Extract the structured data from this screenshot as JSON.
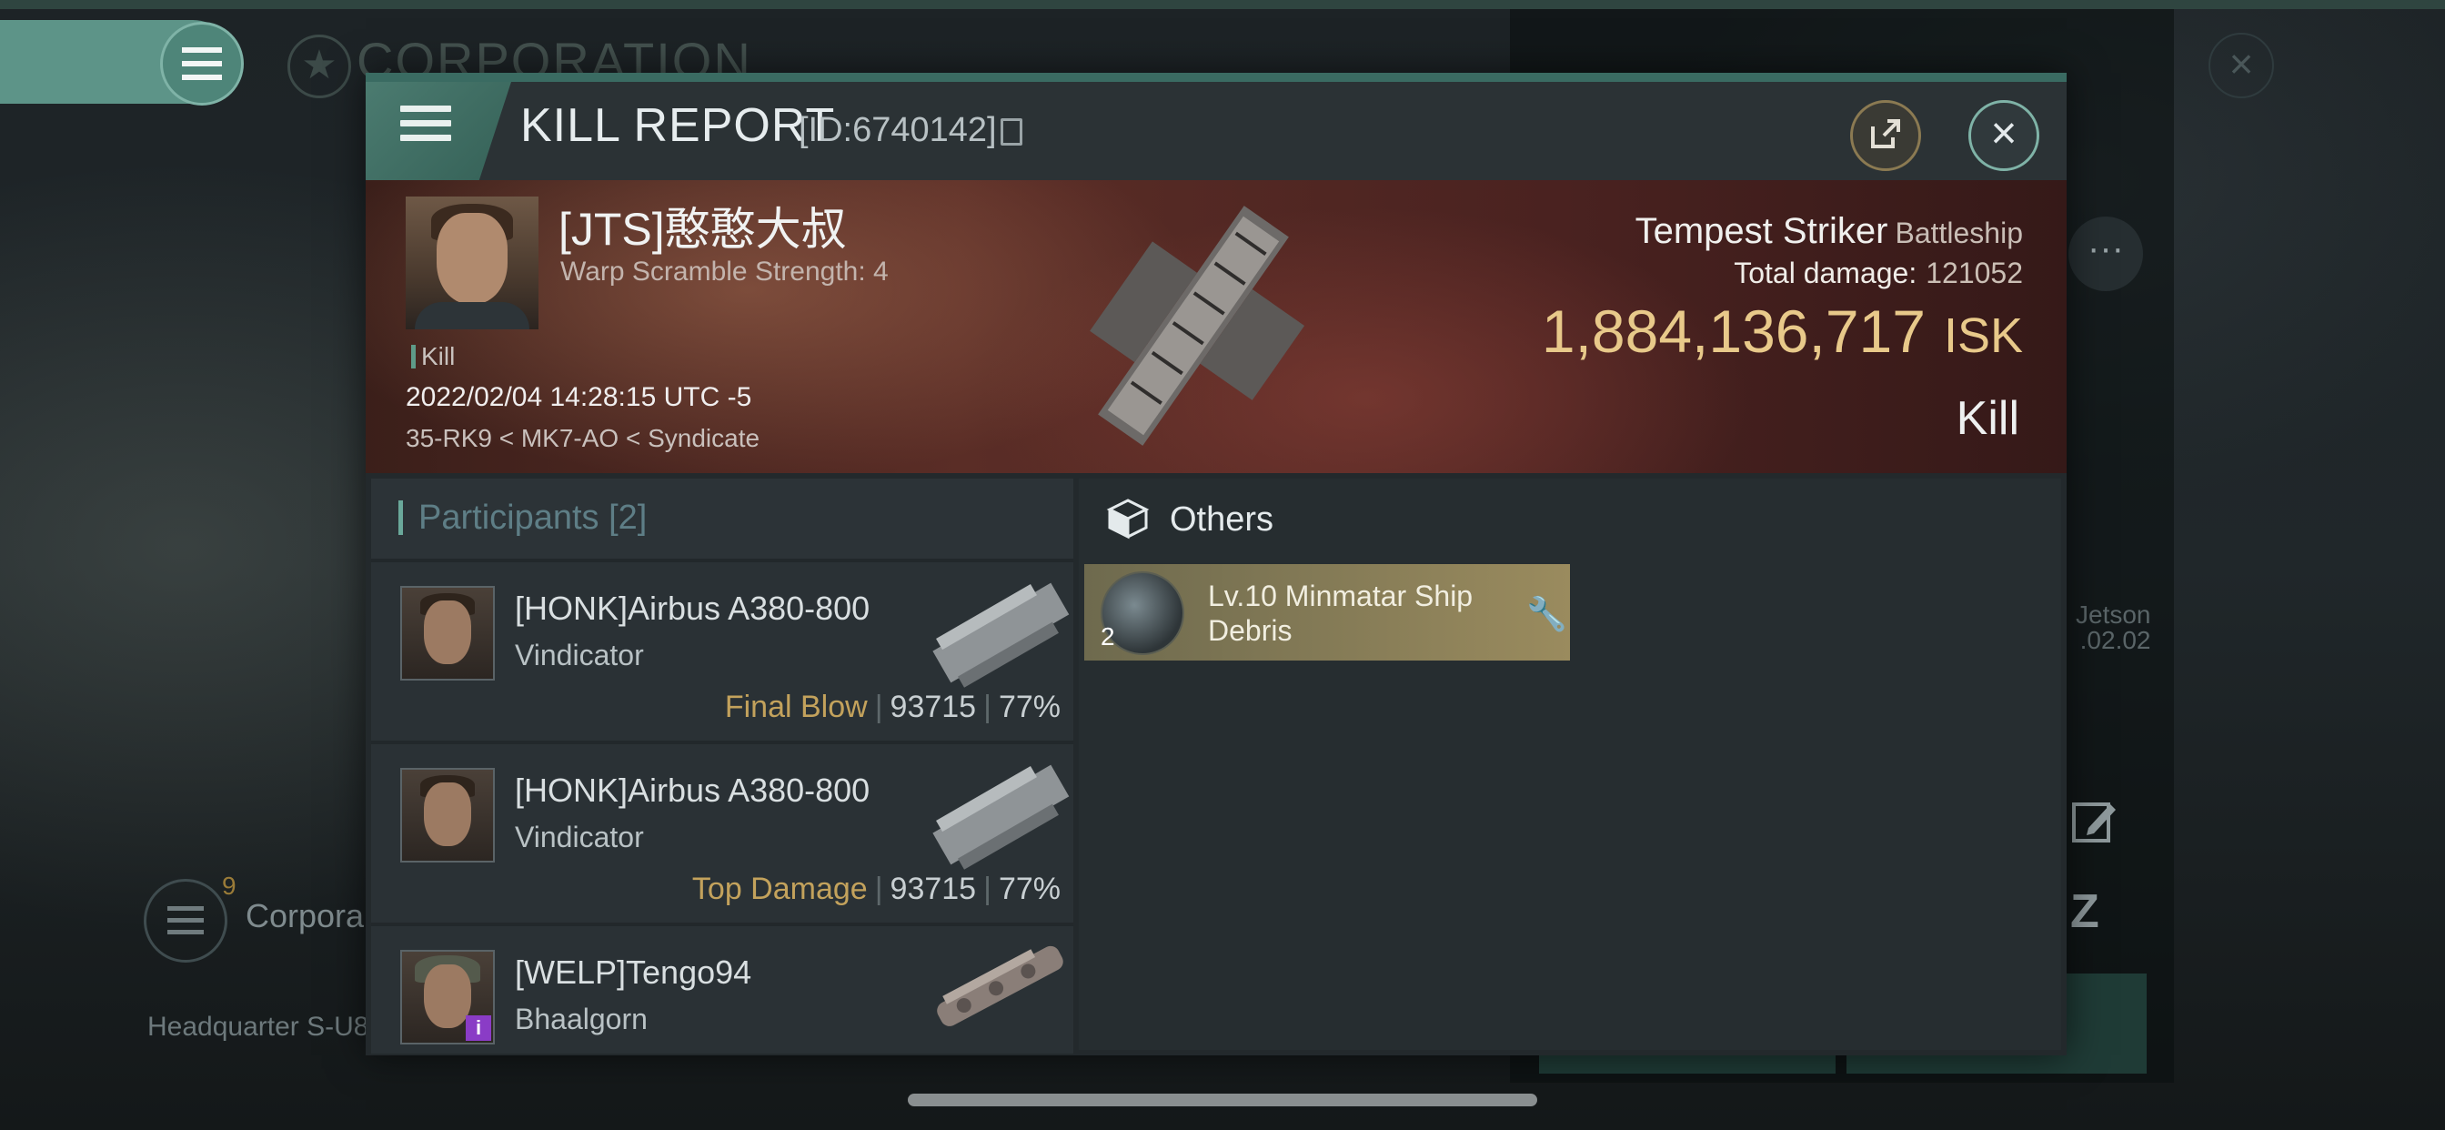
{
  "background": {
    "corp_title": "CORPORATION",
    "jetson_line1": "Jetson",
    "jetson_line2": ".02.02",
    "corp_badge": "9",
    "corp_label": "Corpora",
    "hq_label": "Headquarter S-U8"
  },
  "header": {
    "title": "KILL REPORT",
    "report_id": "[ID:6740142]",
    "share_icon": "share-icon",
    "close_icon": "close-icon"
  },
  "victim": {
    "name": "[JTS]憨憨大叔",
    "subtitle": "Warp Scramble Strength: 4",
    "tag": "Kill",
    "datetime": "2022/02/04 14:28:15 UTC -5",
    "location": "35-RK9 < MK7-AO < Syndicate"
  },
  "ship": {
    "name": "Tempest Striker",
    "class": "Battleship",
    "total_damage_label": "Total damage:",
    "total_damage": "121052",
    "isk_value": "1,884,136,717",
    "isk_unit": "ISK",
    "result": "Kill"
  },
  "participants": {
    "label": "Participants",
    "count": "[2]",
    "items": [
      {
        "name": "[HONK]Airbus A380-800",
        "ship": "Vindicator",
        "role": "Final Blow",
        "damage": "93715",
        "percent": "77%"
      },
      {
        "name": "[HONK]Airbus A380-800",
        "ship": "Vindicator",
        "role": "Top Damage",
        "damage": "93715",
        "percent": "77%"
      },
      {
        "name": "[WELP]Tengo94",
        "ship": "Bhaalgorn",
        "info_badge": "i"
      }
    ]
  },
  "others": {
    "title": "Others",
    "items": [
      {
        "name": "Lv.10 Minmatar Ship Debris",
        "quantity": "2",
        "icon": "wrench-icon"
      }
    ]
  },
  "colors": {
    "accent": "#5d9488",
    "gold": "#e8c98a",
    "role_text": "#c3a25c",
    "item_bg": "#9a8b5e"
  }
}
